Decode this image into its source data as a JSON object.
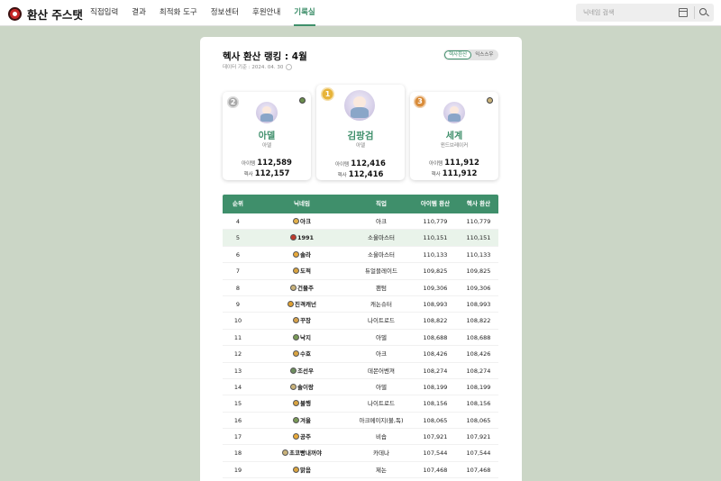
{
  "app": {
    "logo_text": "환산 주스탯"
  },
  "nav": [
    {
      "label": "직접입력",
      "active": false
    },
    {
      "label": "결과",
      "active": false
    },
    {
      "label": "최적화 도구",
      "active": false
    },
    {
      "label": "정보센터",
      "active": false
    },
    {
      "label": "후원안내",
      "active": false
    },
    {
      "label": "기록실",
      "active": true
    }
  ],
  "search": {
    "placeholder": "닉네임 검색"
  },
  "page": {
    "title": "헥사 환산 랭킹 : 4월",
    "date_label": "데이터 기준 : 2024. 04. 30",
    "toggle": [
      "헥사환산",
      "익스스우"
    ],
    "toggle_active": 0
  },
  "podium": [
    {
      "rank": "1",
      "name": "김팡검",
      "job": "아델",
      "item_label": "아이템",
      "item": "112,416",
      "hexa_label": "헥사",
      "hexa": "112,416",
      "medal_color": "#e7b43a"
    },
    {
      "rank": "2",
      "name": "아델",
      "job": "아델",
      "item_label": "아이템",
      "item": "112,589",
      "hexa_label": "헥사",
      "hexa": "112,157",
      "medal_color": "#a9a9a9"
    },
    {
      "rank": "3",
      "name": "세계",
      "job": "윈드브레이커",
      "item_label": "아이템",
      "item": "111,912",
      "hexa_label": "헥사",
      "hexa": "111,912",
      "medal_color": "#d98c3a"
    }
  ],
  "table": {
    "headers": [
      "순위",
      "닉네임",
      "직업",
      "아이템 환산",
      "헥사 환산"
    ],
    "rows": [
      {
        "rank": "4",
        "name": "아크",
        "job": "아크",
        "item": "110,779",
        "hexa": "110,779",
        "highlight": false,
        "emblem": "#e2b04a"
      },
      {
        "rank": "5",
        "name": "1991",
        "job": "소울마스터",
        "item": "110,151",
        "hexa": "110,151",
        "highlight": true,
        "emblem": "#c0392b"
      },
      {
        "rank": "6",
        "name": "솔라",
        "job": "소울마스터",
        "item": "110,133",
        "hexa": "110,133",
        "highlight": false,
        "emblem": "#e8a93a"
      },
      {
        "rank": "7",
        "name": "도적",
        "job": "듀얼블레이드",
        "item": "109,825",
        "hexa": "109,825",
        "highlight": false,
        "emblem": "#d9a441"
      },
      {
        "rank": "8",
        "name": "건물주",
        "job": "팬텀",
        "item": "109,306",
        "hexa": "109,306",
        "highlight": false,
        "emblem": "#c9b27a"
      },
      {
        "rank": "9",
        "name": "진격캐넌",
        "job": "캐논슈터",
        "item": "108,993",
        "hexa": "108,993",
        "highlight": false,
        "emblem": "#e0a030"
      },
      {
        "rank": "10",
        "name": "꾸장",
        "job": "나이트로드",
        "item": "108,822",
        "hexa": "108,822",
        "highlight": false,
        "emblem": "#d6a24c"
      },
      {
        "rank": "11",
        "name": "낙지",
        "job": "아델",
        "item": "108,688",
        "hexa": "108,688",
        "highlight": false,
        "emblem": "#7a9a58"
      },
      {
        "rank": "12",
        "name": "수호",
        "job": "아크",
        "item": "108,426",
        "hexa": "108,426",
        "highlight": false,
        "emblem": "#d9a441"
      },
      {
        "rank": "13",
        "name": "조선우",
        "job": "데몬어벤져",
        "item": "108,274",
        "hexa": "108,274",
        "highlight": false,
        "emblem": "#6f8f60"
      },
      {
        "rank": "14",
        "name": "솔이랑",
        "job": "아델",
        "item": "108,199",
        "hexa": "108,199",
        "highlight": false,
        "emblem": "#c9b27a"
      },
      {
        "rank": "15",
        "name": "불행",
        "job": "나이트로드",
        "item": "108,156",
        "hexa": "108,156",
        "highlight": false,
        "emblem": "#d9a441"
      },
      {
        "rank": "16",
        "name": "겨울",
        "job": "아크메이지(불,독)",
        "item": "108,065",
        "hexa": "108,065",
        "highlight": false,
        "emblem": "#7a9a58"
      },
      {
        "rank": "17",
        "name": "공주",
        "job": "비숍",
        "item": "107,921",
        "hexa": "107,921",
        "highlight": false,
        "emblem": "#e8a93a"
      },
      {
        "rank": "18",
        "name": "초코빵내꺼야",
        "job": "카데나",
        "item": "107,544",
        "hexa": "107,544",
        "highlight": false,
        "emblem": "#c9b27a"
      },
      {
        "rank": "19",
        "name": "맑음",
        "job": "제논",
        "item": "107,468",
        "hexa": "107,468",
        "highlight": false,
        "emblem": "#d9a441"
      }
    ]
  },
  "colors": {
    "accent": "#3f8f6b",
    "background": "#cbd6c6",
    "highlight_row": "#e9f3ea"
  }
}
